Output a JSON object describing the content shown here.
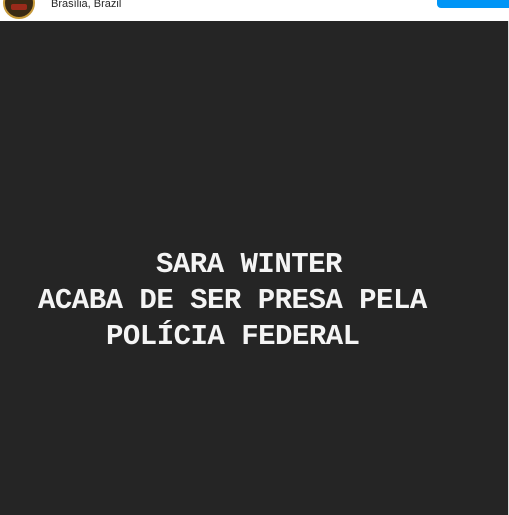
{
  "header": {
    "location": "Brasília, Brazil",
    "avatar_icon": "profile-avatar-icon",
    "follow_button_color": "#0095f6"
  },
  "post": {
    "background_color": "#252525",
    "lines": [
      "SARA WINTER",
      "ACABA DE SER PRESA PELA",
      "POLÍCIA FEDERAL"
    ]
  }
}
